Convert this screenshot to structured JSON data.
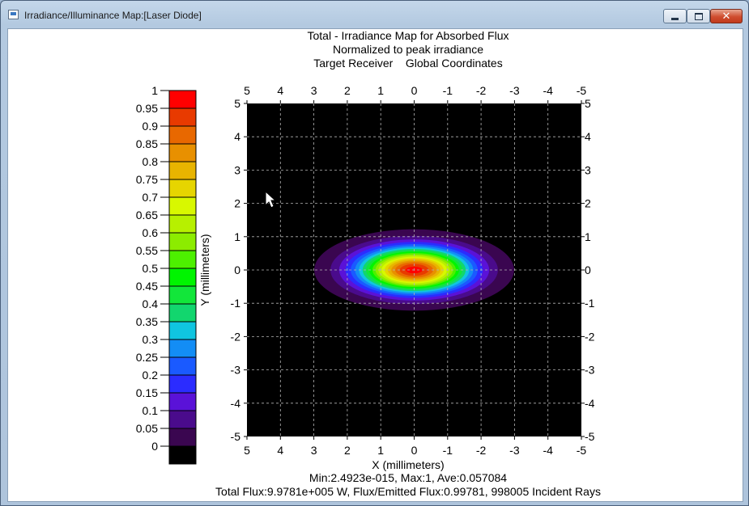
{
  "window": {
    "title": "Irradiance/Illuminance Map:[Laser Diode]",
    "minimize_glyph": "minimize-icon",
    "maximize_glyph": "maximize-icon",
    "close_glyph": "✕"
  },
  "plot": {
    "title_lines": [
      "Total - Irradiance Map for Absorbed Flux",
      "Normalized to peak irradiance",
      "Target Receiver    Global Coordinates"
    ],
    "xlabel": "X (millimeters)",
    "ylabel": "Y (millimeters)",
    "footer_lines": [
      "Min:2.4923e-015, Max:1, Ave:0.057084",
      "Total Flux:9.9781e+005 W, Flux/Emitted Flux:0.99781, 998005 Incident Rays"
    ]
  },
  "chart_data": {
    "type": "heatmap",
    "x_range": [
      5,
      -5
    ],
    "y_range": [
      -5,
      5
    ],
    "x_ticks": [
      "5",
      "4",
      "3",
      "2",
      "1",
      "0",
      "-1",
      "-2",
      "-3",
      "-4",
      "-5"
    ],
    "y_ticks": [
      "5",
      "4",
      "3",
      "2",
      "1",
      "0",
      "-1",
      "-2",
      "-3",
      "-4",
      "-5"
    ],
    "grid": true,
    "background_color": "#000000",
    "beam": {
      "center_x": 0,
      "center_y": 0,
      "sigma_x": 1.1,
      "sigma_y": 0.45
    },
    "colorbar": {
      "min": 0,
      "max": 1,
      "step": 0.05,
      "tick_labels": [
        "1",
        "0.95",
        "0.9",
        "0.85",
        "0.8",
        "0.75",
        "0.7",
        "0.65",
        "0.6",
        "0.55",
        "0.5",
        "0.45",
        "0.4",
        "0.35",
        "0.3",
        "0.25",
        "0.2",
        "0.15",
        "0.1",
        "0.05",
        "0"
      ],
      "colors": [
        "#000000",
        "#3a0650",
        "#4a0b8c",
        "#5a12d8",
        "#2b2cff",
        "#1a5aff",
        "#138df5",
        "#10c5e0",
        "#12d66e",
        "#12e63a",
        "#00f500",
        "#4df000",
        "#8cec00",
        "#b7f000",
        "#d8f800",
        "#e6d500",
        "#e8b400",
        "#e89000",
        "#e86800",
        "#e83a00",
        "#ff0000"
      ]
    }
  }
}
